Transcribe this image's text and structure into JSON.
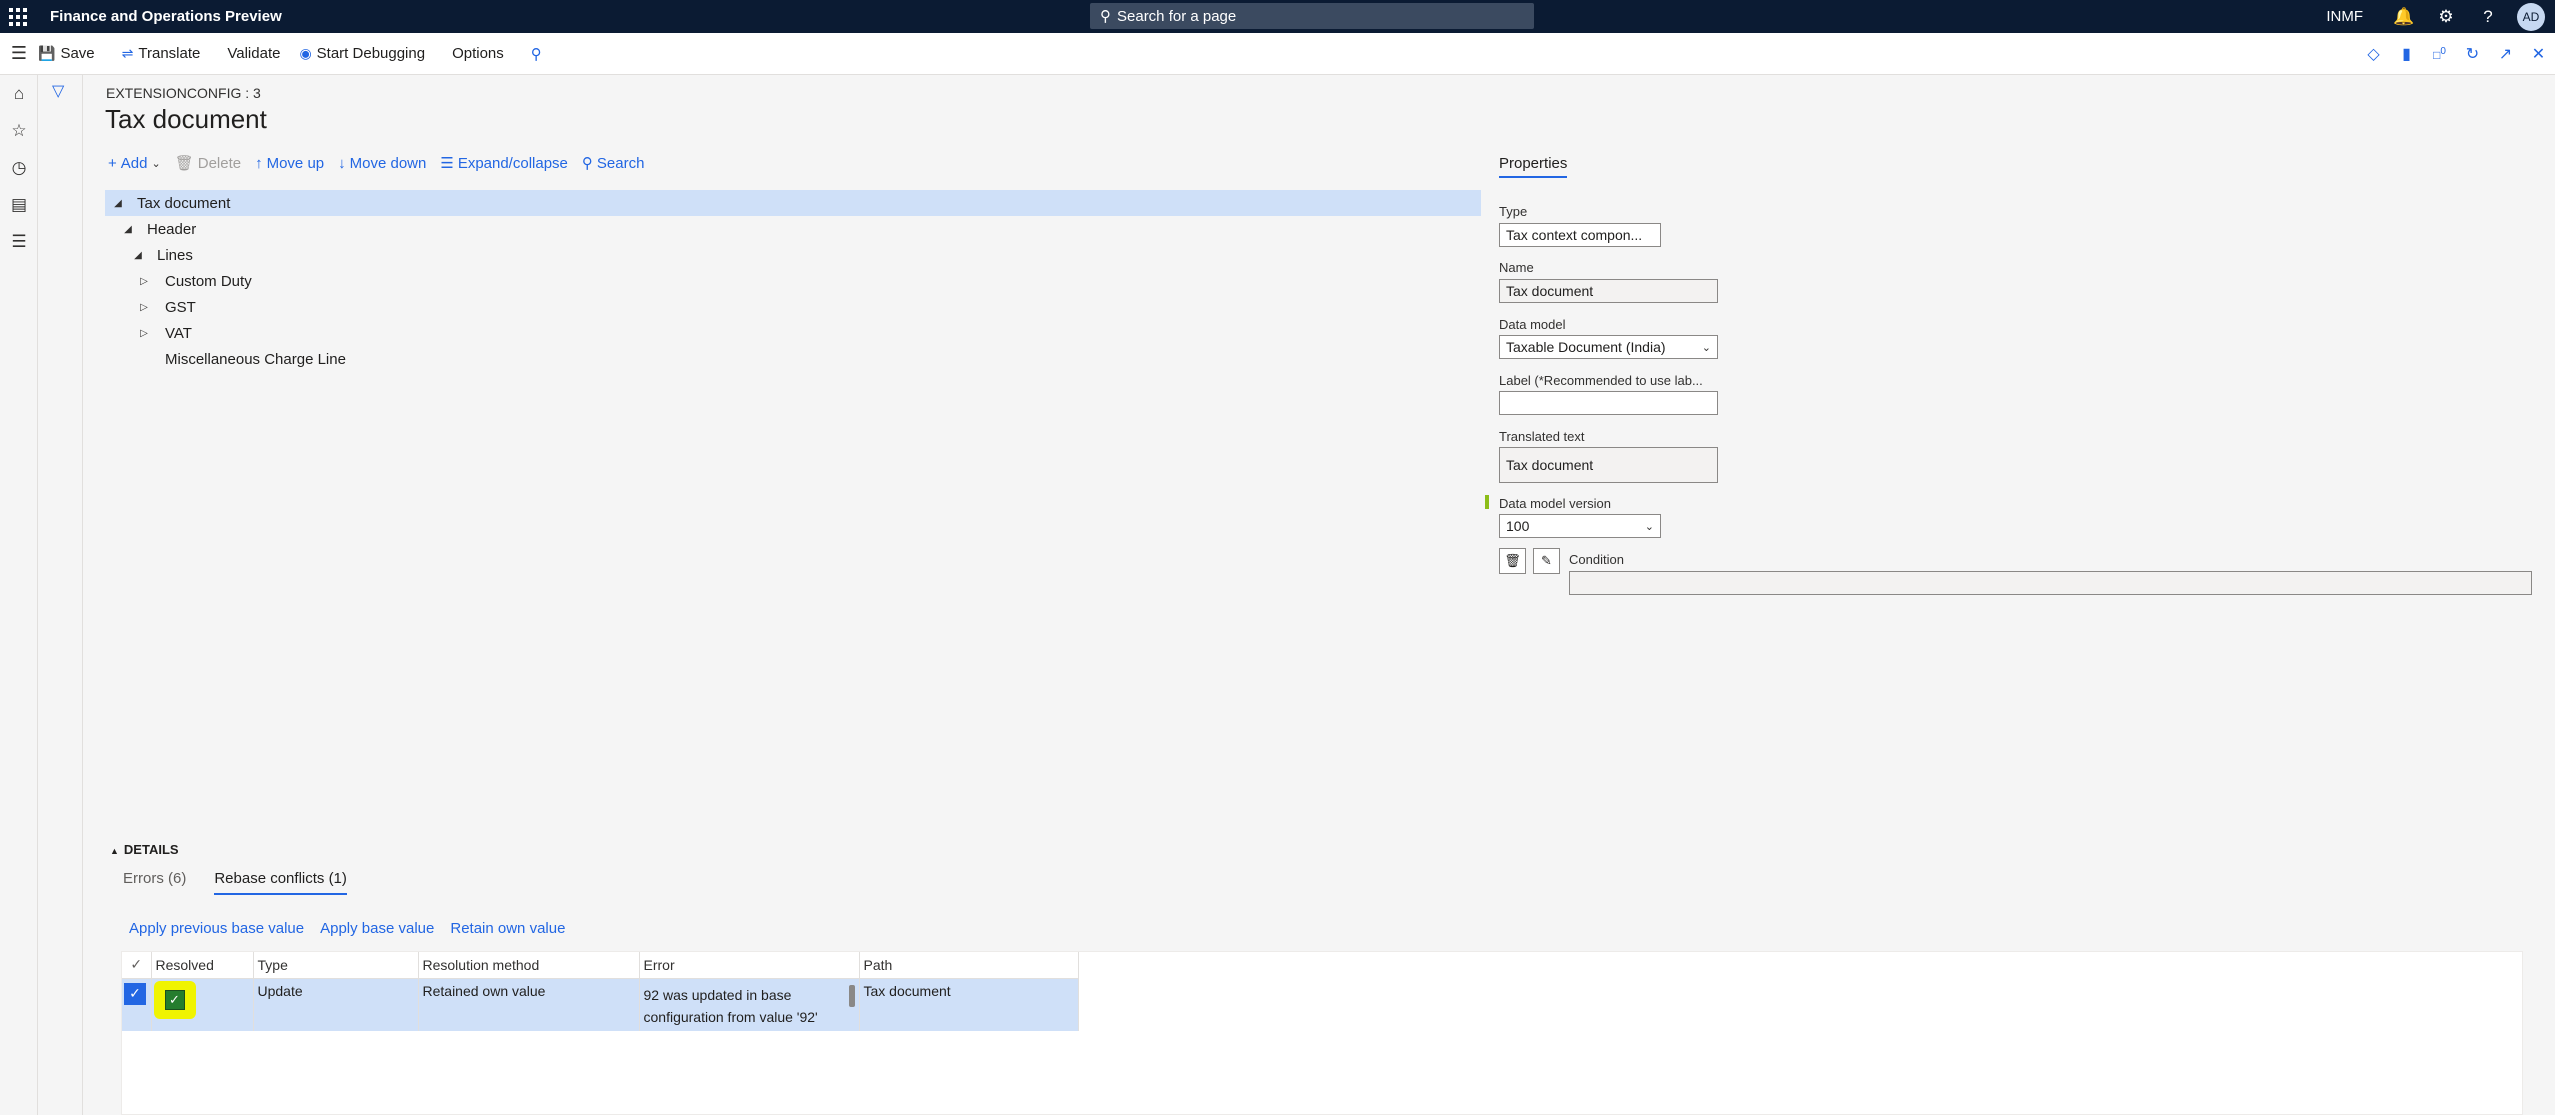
{
  "topbar": {
    "app_title": "Finance and Operations Preview",
    "search_placeholder": "Search for a page",
    "company": "INMF",
    "avatar_initials": "AD",
    "bell_icon": "bell-icon",
    "settings_icon": "gear-icon",
    "help_icon": "help-icon"
  },
  "actionbar": {
    "save": "Save",
    "translate": "Translate",
    "validate": "Validate",
    "start_debugging": "Start Debugging",
    "options": "Options",
    "notification_count": "0"
  },
  "page": {
    "breadcrumb": "EXTENSIONCONFIG : 3",
    "title": "Tax document"
  },
  "tree_toolbar": {
    "add": "Add",
    "delete": "Delete",
    "move_up": "Move up",
    "move_down": "Move down",
    "expand_collapse": "Expand/collapse",
    "search": "Search"
  },
  "tree": {
    "root": "Tax document",
    "header": "Header",
    "lines": "Lines",
    "custom_duty": "Custom Duty",
    "gst": "GST",
    "vat": "VAT",
    "misc": "Miscellaneous Charge Line"
  },
  "properties": {
    "tab": "Properties",
    "type_label": "Type",
    "type_value": "Tax context compon...",
    "name_label": "Name",
    "name_value": "Tax document",
    "data_model_label": "Data model",
    "data_model_value": "Taxable Document (India)",
    "label_label": "Label (*Recommended to use lab...",
    "label_value": "",
    "translated_label": "Translated text",
    "translated_value": "Tax document",
    "dm_version_label": "Data model version",
    "dm_version_value": "100",
    "condition_label": "Condition",
    "condition_value": ""
  },
  "details": {
    "header": "DETAILS",
    "tab_errors": "Errors (6)",
    "tab_rebase": "Rebase conflicts (1)",
    "link_apply_prev": "Apply previous base value",
    "link_apply_base": "Apply base value",
    "link_retain": "Retain own value",
    "columns": {
      "resolved": "Resolved",
      "type": "Type",
      "resolution_method": "Resolution method",
      "error": "Error",
      "path": "Path"
    },
    "rows": [
      {
        "resolved": true,
        "type": "Update",
        "resolution_method": "Retained own value",
        "error_line1": "92 was updated in base",
        "error_line2": "configuration from value '92'",
        "path": "Tax document"
      }
    ]
  },
  "colors": {
    "topbar_bg": "#0b1b33",
    "accent": "#2266e3",
    "selection": "#cfe0f8",
    "highlight": "#f0f400",
    "resolved_check": "#257d2e"
  }
}
